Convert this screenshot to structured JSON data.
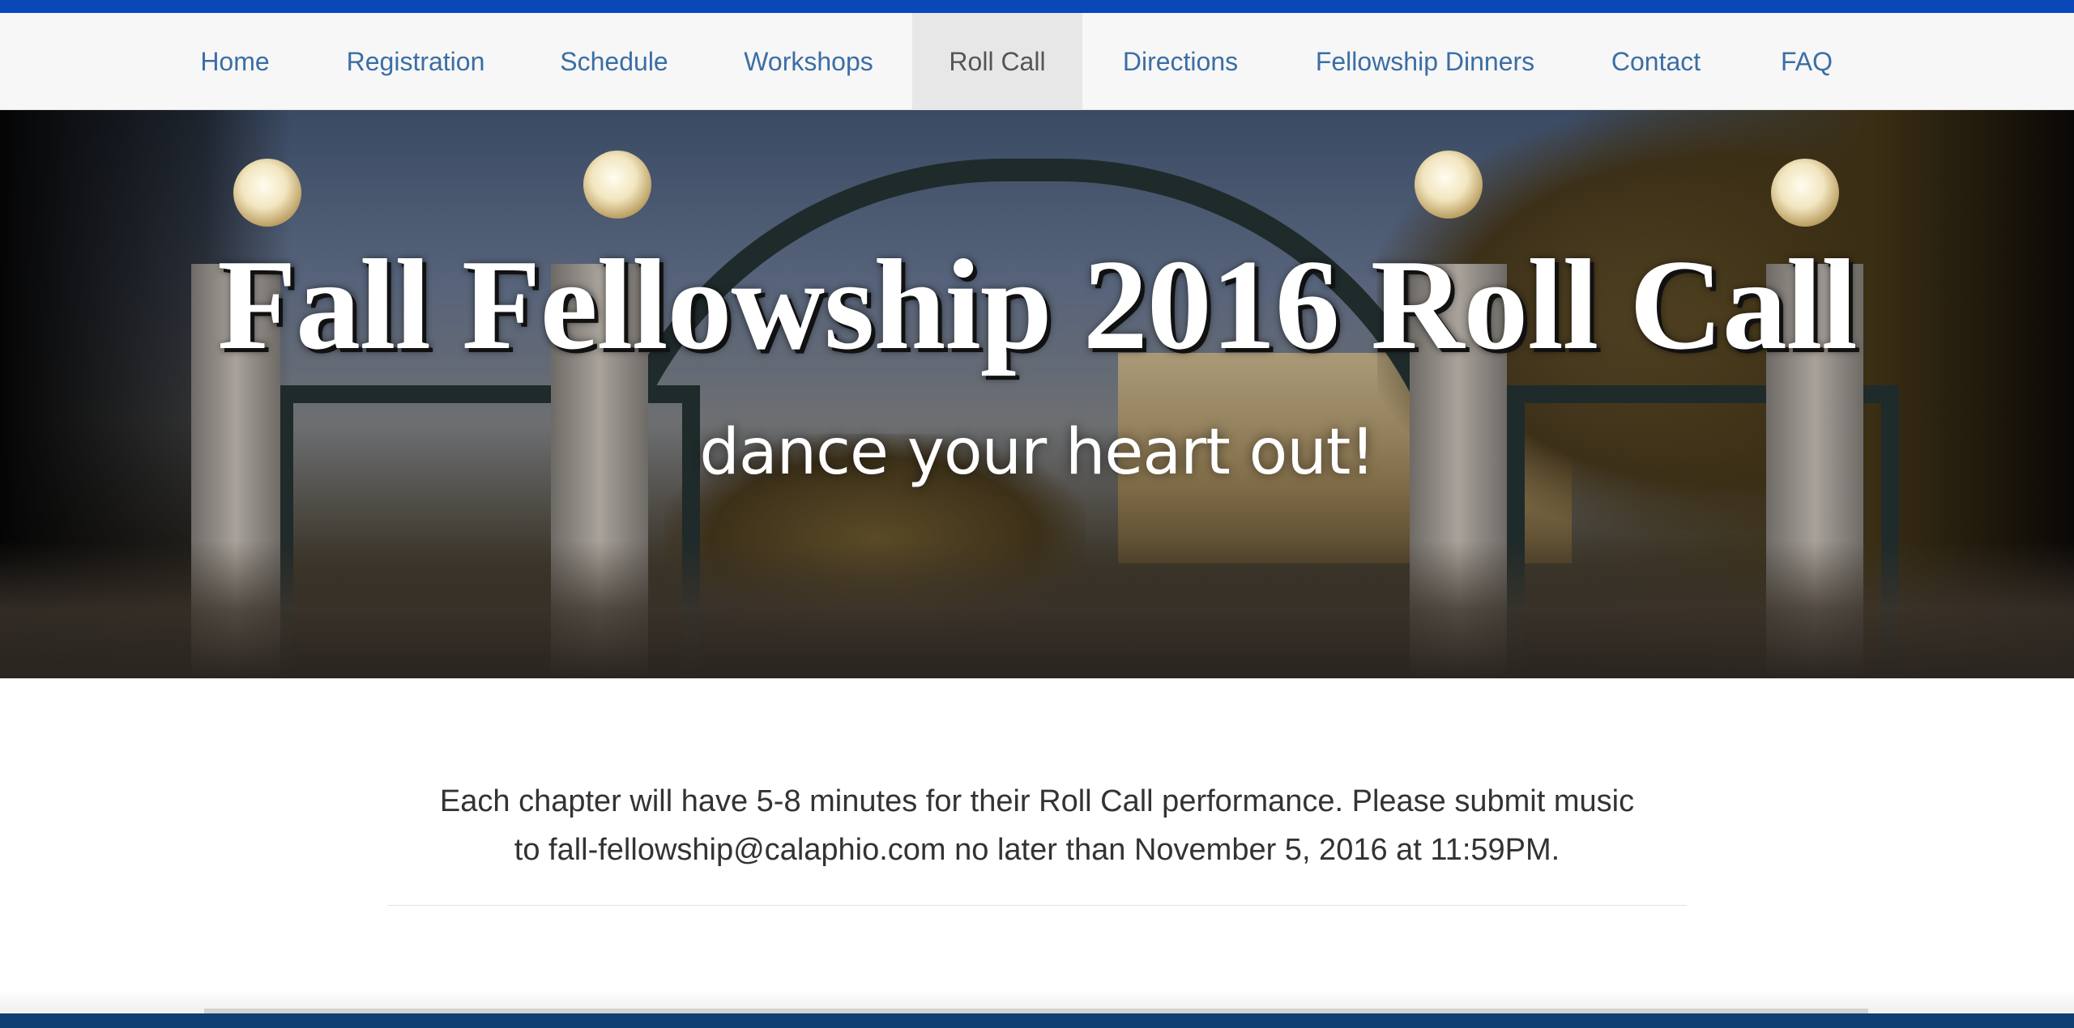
{
  "nav": {
    "items": [
      {
        "label": "Home",
        "active": false
      },
      {
        "label": "Registration",
        "active": false
      },
      {
        "label": "Schedule",
        "active": false
      },
      {
        "label": "Workshops",
        "active": false
      },
      {
        "label": "Roll Call",
        "active": true
      },
      {
        "label": "Directions",
        "active": false
      },
      {
        "label": "Fellowship Dinners",
        "active": false
      },
      {
        "label": "Contact",
        "active": false
      },
      {
        "label": "FAQ",
        "active": false
      }
    ]
  },
  "hero": {
    "title": "Fall Fellowship 2016 Roll Call",
    "subtitle": "dance your heart out!"
  },
  "content": {
    "line1": "Each chapter will have 5-8 minutes for their Roll Call performance. Please submit music",
    "line2": "to fall-fellowship@calaphio.com no later than November 5, 2016 at 11:59PM."
  },
  "colors": {
    "accent_stripe": "#0a47b8",
    "nav_link": "#3b6ea5",
    "nav_active_bg": "#e7e7e7",
    "footer_bar": "#0d3f73"
  }
}
